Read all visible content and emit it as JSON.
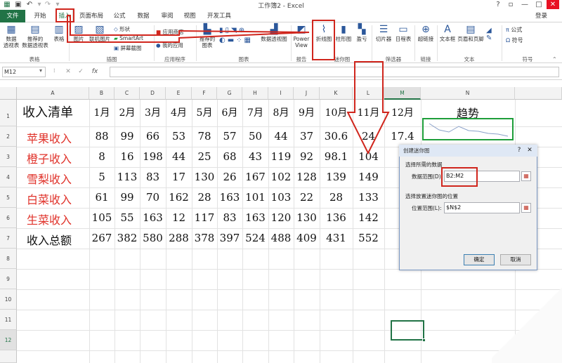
{
  "window": {
    "title": "工作簿2 - Excel",
    "controls": [
      "?",
      "▫",
      "—",
      "□",
      "✕"
    ]
  },
  "tabs": [
    "文件",
    "开始",
    "插入",
    "页面布局",
    "公式",
    "数据",
    "审阅",
    "视图",
    "开发工具"
  ],
  "login_label": "登录",
  "ribbon": {
    "pivot_table": "数据\n透视表",
    "recommended_pivot": "推荐的\n数据透视表",
    "table": "表格",
    "pictures": "图片",
    "online_pictures": "联机图片",
    "shapes": "形状",
    "smartart": "SmartArt",
    "screenshot": "屏幕截图",
    "store": "应用商店",
    "my_apps": "我的应用",
    "recommended_charts": "推荐的\n图表",
    "pivot_chart": "数据透视图",
    "power_view": "Power\nView",
    "sparkline_line": "折线图",
    "sparkline_column": "柱形图",
    "sparkline_winloss": "盈亏",
    "slicer": "切片器",
    "timeline": "日程表",
    "hyperlink": "超链接",
    "textbox": "文本框",
    "header_footer": "页眉和页脚",
    "equation": "公式",
    "symbol": "符号",
    "groups": {
      "tables": "表格",
      "illustrations": "插图",
      "apps": "应用程序",
      "charts": "图表",
      "reports": "报告",
      "sparklines": "迷你图",
      "filters": "筛选器",
      "links": "链接",
      "text": "文本",
      "symbols": "符号"
    }
  },
  "formula_bar": {
    "name_box": "M12",
    "cancel": "✕",
    "enter": "✓",
    "fx": "fx",
    "value": ""
  },
  "columns": [
    "A",
    "B",
    "C",
    "D",
    "E",
    "F",
    "G",
    "H",
    "I",
    "J",
    "K",
    "L",
    "M",
    "N"
  ],
  "rows": [
    "1",
    "2",
    "3",
    "4",
    "5",
    "6",
    "7",
    "8",
    "9",
    "10",
    "11",
    "12"
  ],
  "sheet": {
    "header": {
      "label": "收入清单",
      "months": [
        "1月",
        "2月",
        "3月",
        "4月",
        "5月",
        "6月",
        "7月",
        "8月",
        "9月",
        "10月",
        "11月",
        "12月"
      ],
      "trend": "趋势"
    },
    "data_rows": [
      {
        "label": "苹果收入",
        "values": [
          "88",
          "99",
          "66",
          "53",
          "78",
          "57",
          "50",
          "44",
          "37",
          "30.6",
          "24",
          "17.4"
        ]
      },
      {
        "label": "橙子收入",
        "values": [
          "8",
          "16",
          "198",
          "44",
          "25",
          "68",
          "43",
          "119",
          "92",
          "98.1",
          "104",
          ""
        ]
      },
      {
        "label": "雪梨收入",
        "values": [
          "5",
          "113",
          "83",
          "17",
          "130",
          "26",
          "167",
          "102",
          "128",
          "139",
          "149",
          ""
        ]
      },
      {
        "label": "白菜收入",
        "values": [
          "61",
          "99",
          "70",
          "162",
          "28",
          "163",
          "101",
          "103",
          "22",
          "28",
          "133",
          ""
        ]
      },
      {
        "label": "生菜收入",
        "values": [
          "105",
          "55",
          "163",
          "12",
          "117",
          "83",
          "163",
          "120",
          "130",
          "136",
          "142",
          ""
        ]
      },
      {
        "label": "收入总额",
        "values": [
          "267",
          "382",
          "580",
          "288",
          "378",
          "397",
          "524",
          "488",
          "409",
          "431",
          "552",
          ""
        ]
      }
    ]
  },
  "dialog": {
    "title": "创建迷你图",
    "section1": "选择所需的数据",
    "data_range_label": "数据范围(D):",
    "data_range_value": "B2:M2",
    "section2": "选择放置迷你图的位置",
    "location_label": "位置范围(L):",
    "location_value": "$N$2",
    "ok": "确定",
    "cancel": "取消",
    "help": "?",
    "close": "✕"
  },
  "colors": {
    "excel_green": "#217346",
    "annotation_red": "#d0261d",
    "sparkline_green": "#1e9e3a",
    "label_red": "#e0332b"
  }
}
